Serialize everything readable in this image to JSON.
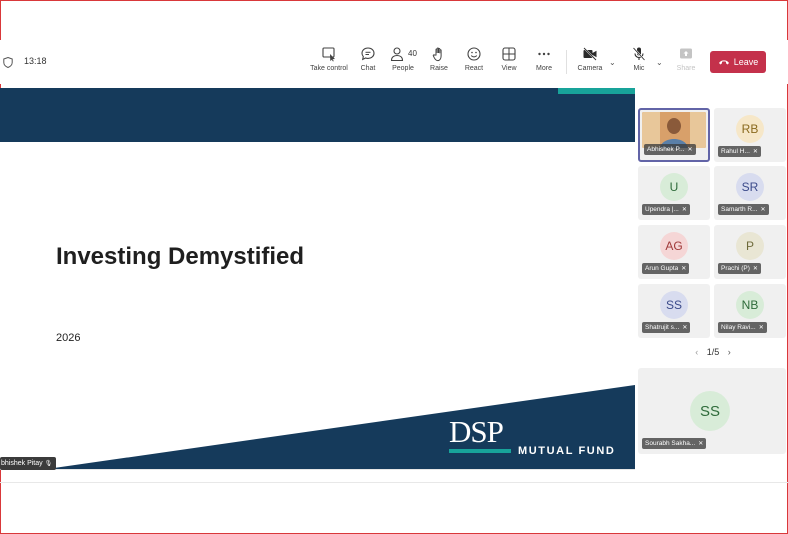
{
  "status": {
    "time": "13:18"
  },
  "toolbar": {
    "take_control": "Take control",
    "chat": "Chat",
    "people": "People",
    "people_count": "40",
    "raise": "Raise",
    "react": "React",
    "view": "View",
    "more": "More",
    "camera": "Camera",
    "mic": "Mic",
    "share": "Share",
    "leave": "Leave"
  },
  "slide": {
    "title": "Investing Demystified",
    "year": "2026",
    "logo_main": "DSP",
    "logo_sub": "MUTUAL FUND",
    "presenter": "bhishek Pitay"
  },
  "participants": [
    {
      "name": "Abhishek P...",
      "initials": "",
      "video": true,
      "avatar_bg": "#c88956",
      "avatar_fg": "#ffffff"
    },
    {
      "name": "Rahul H...",
      "initials": "RB",
      "avatar_bg": "#f6e7c8",
      "avatar_fg": "#8a6a1e"
    },
    {
      "name": "Upendra |...",
      "initials": "U",
      "avatar_bg": "#d8ecd8",
      "avatar_fg": "#2e6b3a"
    },
    {
      "name": "Samarth R...",
      "initials": "SR",
      "avatar_bg": "#d8dcef",
      "avatar_fg": "#3b4a8a"
    },
    {
      "name": "Arun Gupta",
      "initials": "AG",
      "avatar_bg": "#f5d6d6",
      "avatar_fg": "#a03a3a"
    },
    {
      "name": "Prachi (P)",
      "initials": "P",
      "avatar_bg": "#e9e6d4",
      "avatar_fg": "#6e6a3a"
    },
    {
      "name": "Shatrujit s...",
      "initials": "SS",
      "avatar_bg": "#d8dcef",
      "avatar_fg": "#3b4a8a"
    },
    {
      "name": "Nilay Ravi...",
      "initials": "NB",
      "avatar_bg": "#d8ecd8",
      "avatar_fg": "#2e6b3a"
    }
  ],
  "pager": {
    "label": "1/5"
  },
  "featured": {
    "name": "Sourabh Sakha...",
    "initials": "SS",
    "avatar_bg": "#d8ecd8",
    "avatar_fg": "#2e6b3a"
  },
  "colors": {
    "slide_navy": "#153a5b",
    "accent_teal": "#18a39a",
    "leave_red": "#c4314b",
    "frame_red": "#d9383a"
  },
  "icons": [
    "shield-icon",
    "take-control-icon",
    "chat-icon",
    "people-icon",
    "raise-hand-icon",
    "react-icon",
    "view-icon",
    "more-icon",
    "camera-off-icon",
    "mic-off-icon",
    "share-icon",
    "phone-hangup-icon"
  ]
}
